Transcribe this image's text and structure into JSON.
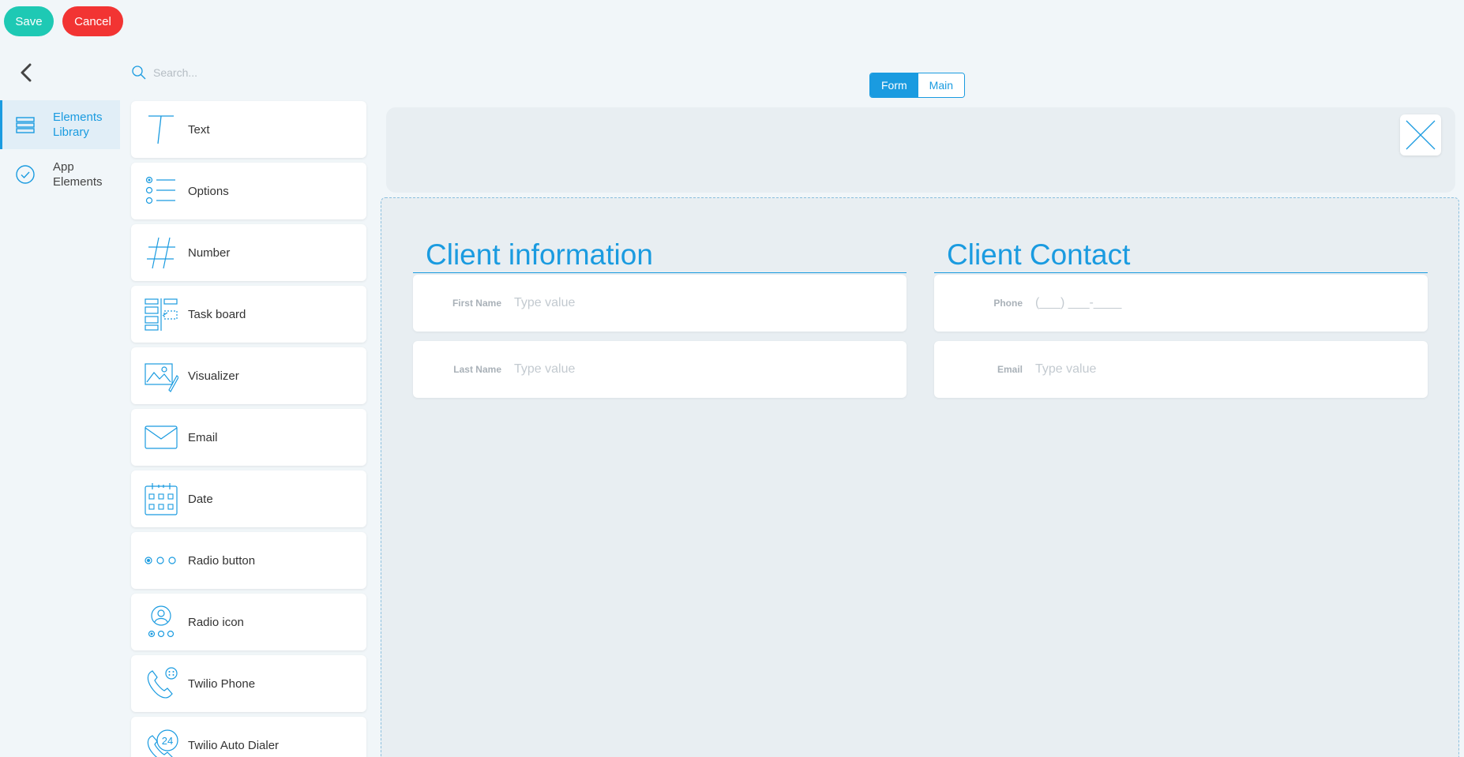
{
  "toolbar": {
    "save_label": "Save",
    "cancel_label": "Cancel"
  },
  "sidebar": {
    "items": [
      {
        "label": "Elements Library",
        "icon": "layers-icon",
        "active": true
      },
      {
        "label": "App Elements",
        "icon": "check-circle-icon",
        "active": false
      }
    ]
  },
  "search": {
    "placeholder": "Search..."
  },
  "library": {
    "items": [
      {
        "label": "Text",
        "icon": "text-icon"
      },
      {
        "label": "Options",
        "icon": "options-list-icon"
      },
      {
        "label": "Number",
        "icon": "hash-icon"
      },
      {
        "label": "Task board",
        "icon": "task-board-icon"
      },
      {
        "label": "Visualizer",
        "icon": "image-pen-icon"
      },
      {
        "label": "Email",
        "icon": "envelope-icon"
      },
      {
        "label": "Date",
        "icon": "calendar-icon"
      },
      {
        "label": "Radio button",
        "icon": "radio-dots-icon"
      },
      {
        "label": "Radio icon",
        "icon": "user-radio-icon"
      },
      {
        "label": "Twilio Phone",
        "icon": "phone-icon"
      },
      {
        "label": "Twilio Auto Dialer",
        "icon": "phone-24-icon"
      }
    ]
  },
  "view_toggle": {
    "form_label": "Form",
    "main_label": "Main",
    "selected": "Form"
  },
  "form": {
    "sections": [
      {
        "title": "Client information",
        "fields": [
          {
            "label": "First Name",
            "placeholder": "Type value"
          },
          {
            "label": "Last Name",
            "placeholder": "Type value"
          }
        ]
      },
      {
        "title": "Client Contact",
        "fields": [
          {
            "label": "Phone",
            "placeholder": "(___) ___-____"
          },
          {
            "label": "Email",
            "placeholder": "Type value"
          }
        ]
      }
    ]
  },
  "colors": {
    "accent": "#1a9be0",
    "save": "#1ec9b4",
    "cancel": "#f23433",
    "background": "#f1f6f9"
  }
}
